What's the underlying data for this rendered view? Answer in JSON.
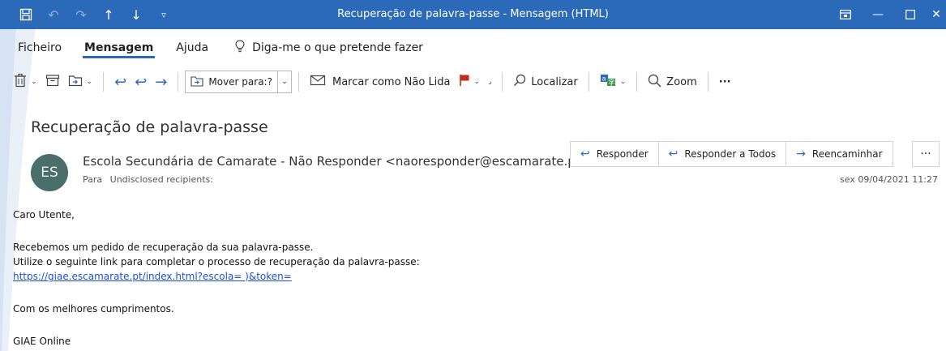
{
  "window": {
    "title": "Recuperação de palavra-passe  -  Mensagem (HTML)",
    "accent": "#2a6ab8"
  },
  "tabs": {
    "file": "Ficheiro",
    "message": "Mensagem",
    "help": "Ajuda",
    "tell_me": "Diga-me o que pretende fazer"
  },
  "toolbar": {
    "move_to": "Mover para:?",
    "mark_unread": "Marcar como Não Lida",
    "find": "Localizar",
    "zoom": "Zoom",
    "more": "···"
  },
  "message": {
    "subject": "Recuperação de palavra-passe",
    "avatar_initials": "ES",
    "avatar_color": "#4a6e6a",
    "sender": "Escola Secundária de Camarate - Não Responder <naoresponder@escamarate.pt>",
    "to_label": "Para",
    "recipients": "Undisclosed recipients:",
    "datetime": "sex 09/04/2021 11:27",
    "actions": {
      "reply": "Responder",
      "reply_all": "Responder a Todos",
      "forward": "Reencaminhar",
      "more": "···"
    }
  },
  "body": {
    "greeting": "Caro Utente,",
    "line1": "Recebemos um pedido de recuperação da sua palavra-passe.",
    "line2": "Utilize o seguinte link para completar o processo de recuperação da palavra-passe:",
    "link": "https://giae.escamarate.pt/index.html?escola=        )&token=",
    "closing": "Com os melhores cumprimentos.",
    "signature": "GIAE Online"
  }
}
